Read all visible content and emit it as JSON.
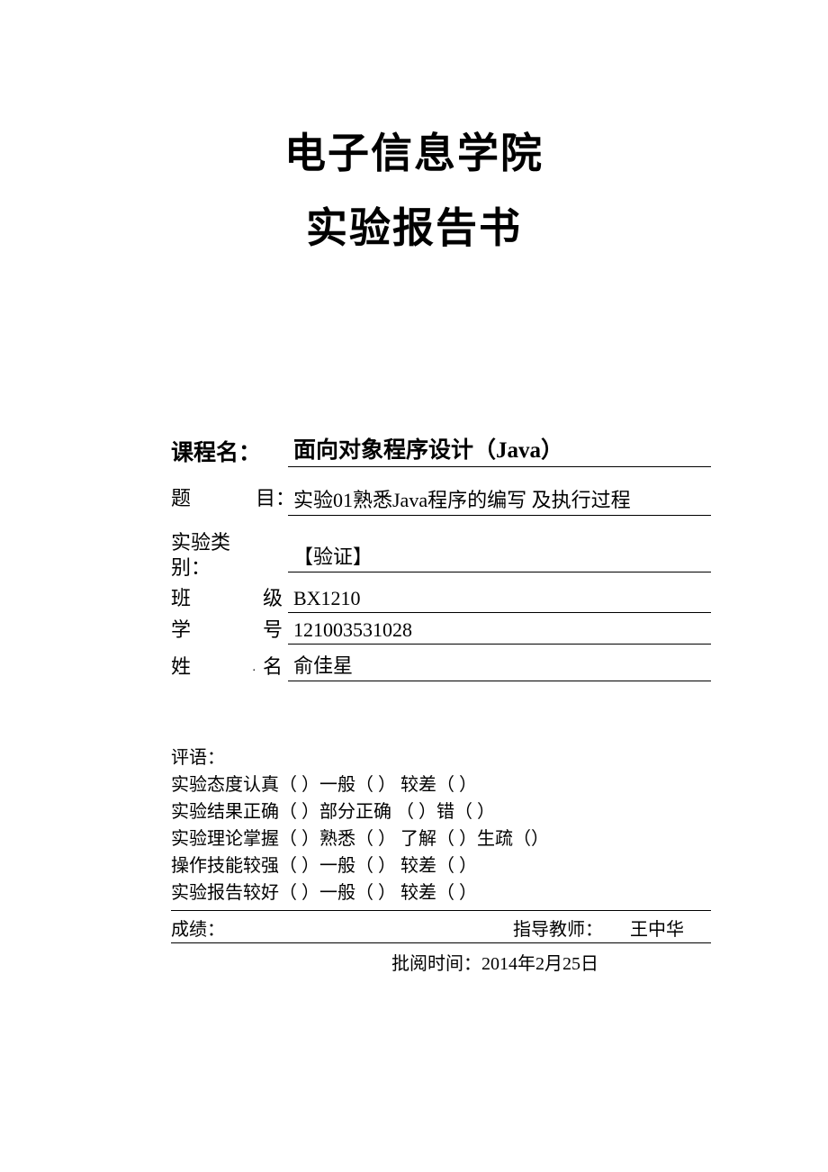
{
  "title": {
    "line1": "电子信息学院",
    "line2": "实验报告书"
  },
  "info": {
    "course_label": "课程名：",
    "course_value": "面向对象程序设计（Java）",
    "topic_label_c1": "题",
    "topic_label_c2": "目：",
    "topic_value": "实验01熟悉Java程序的编写  及执行过程",
    "type_label1": "实验类",
    "type_label2": "别：",
    "type_value": "【验证】",
    "class_label_c1": "班",
    "class_label_c2": "级",
    "class_value": "BX1210",
    "id_label_c1": "学",
    "id_label_c2": "号",
    "id_value": "121003531028",
    "name_label_c1": "姓",
    "name_label_c2": "名",
    "name_value": "俞佳星"
  },
  "eval": {
    "comment_label": "评语：",
    "rows": [
      {
        "label": "实验态度：",
        "content": "认真（    ）一般（      ）  较差（    ）"
      },
      {
        "label": "实验结果：",
        "content": "正确（    ）部分正确  （    ）错（      ）"
      },
      {
        "label": "实验理论：",
        "content": "掌握（    ）熟悉（      ）  了解（      ）生疏（）"
      },
      {
        "label": "操作技能：",
        "content": "较强（    ）一般（      ）  较差（    ）"
      },
      {
        "label": "实验报告：",
        "content": "较好（    ）一般（      ）  较差（    ）"
      }
    ],
    "grade_label": "成绩：",
    "teacher_label": "指导教师：",
    "teacher_name": "王中华",
    "review_date": "批阅时间：2014年2月25日"
  }
}
